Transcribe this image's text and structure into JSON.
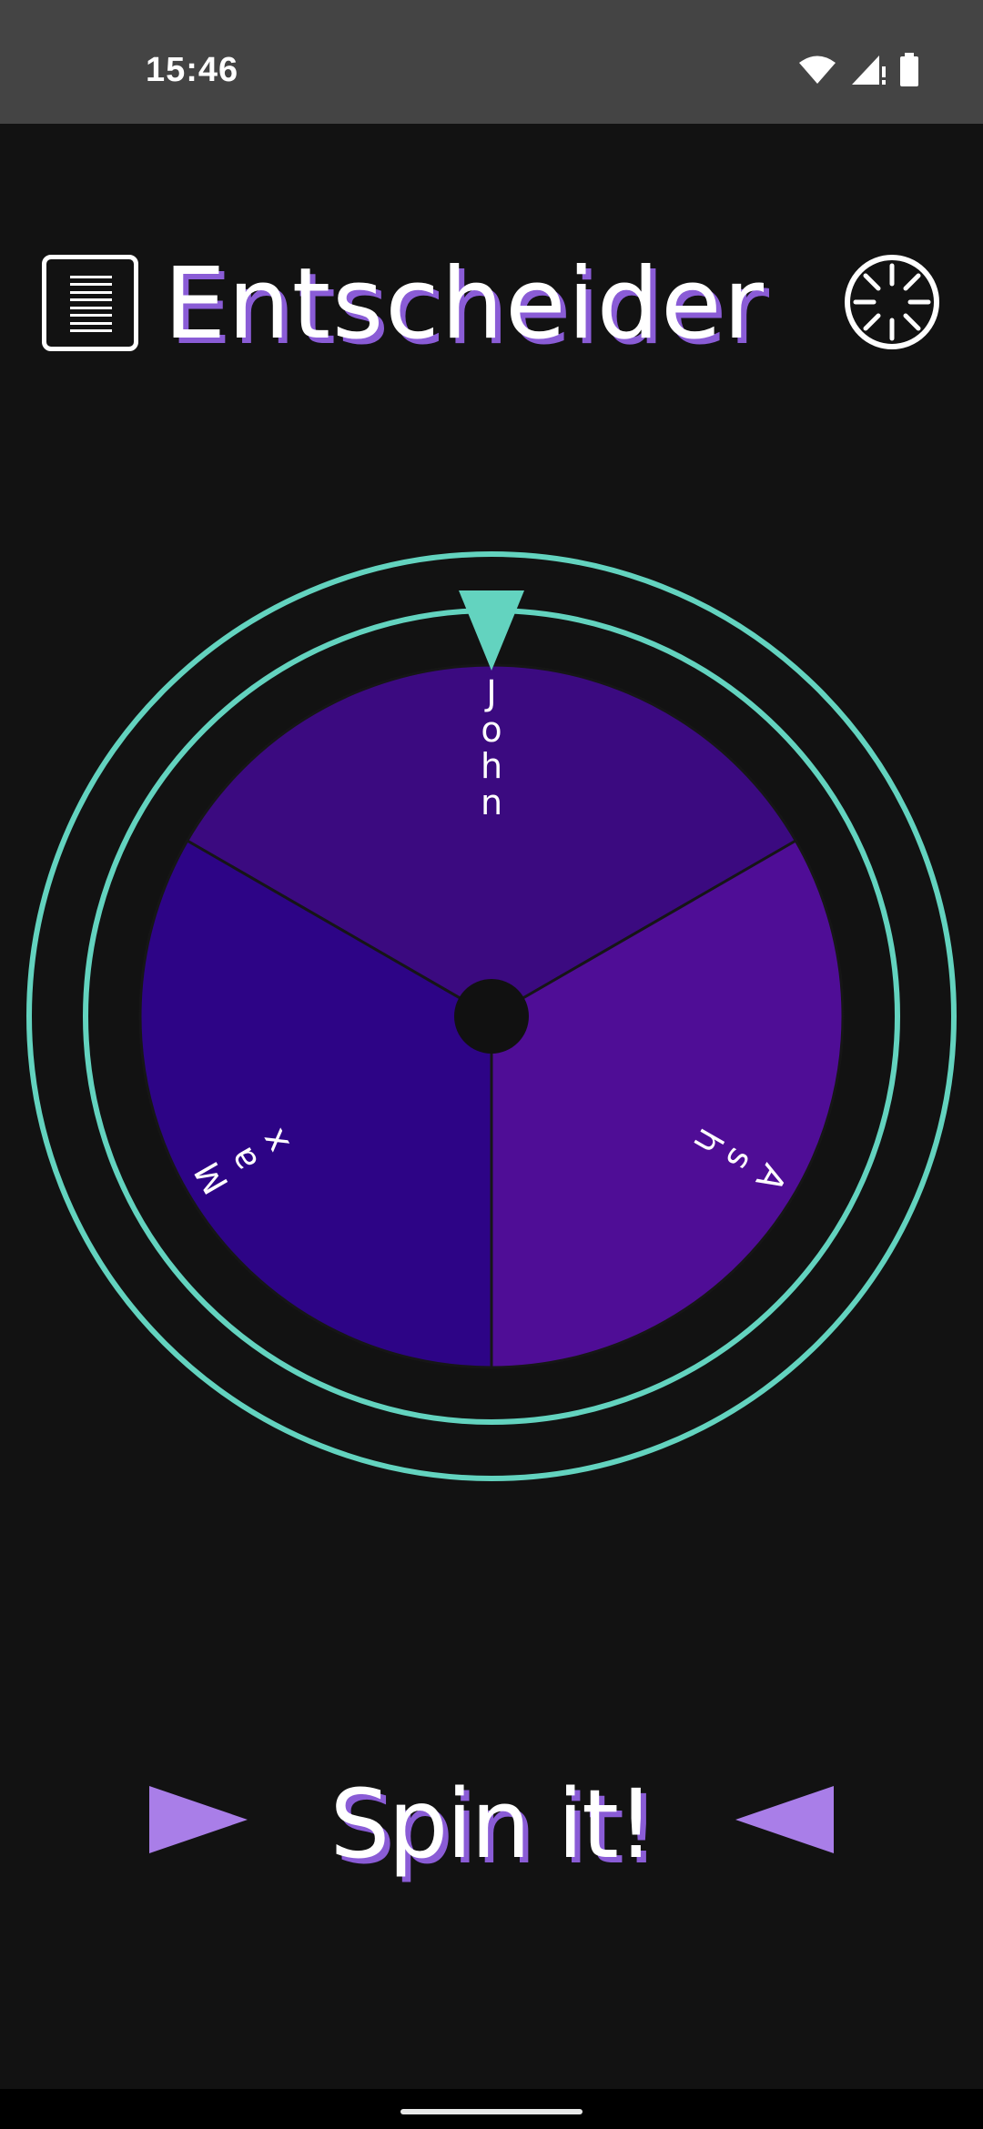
{
  "status_bar": {
    "time": "15:46",
    "icons": [
      "wifi-icon",
      "signal-icon",
      "battery-icon"
    ]
  },
  "header": {
    "title": "Entscheider",
    "menu_icon": "list-icon",
    "settings_icon": "loading-spinner-icon"
  },
  "wheel": {
    "segments": [
      {
        "label": "John",
        "color": "#3b0a80"
      },
      {
        "label": "Ash",
        "color": "#4f0d96"
      },
      {
        "label": "Max",
        "color": "#2d0486"
      }
    ],
    "ring_color": "#63d3bf",
    "pointer_color": "#63d3bf",
    "hub_color": "#111111"
  },
  "spin": {
    "label": "Spin it!",
    "arrow_color": "#a97ee8"
  },
  "colors": {
    "background": "#121212",
    "title_shadow": "#8a5cd6"
  }
}
